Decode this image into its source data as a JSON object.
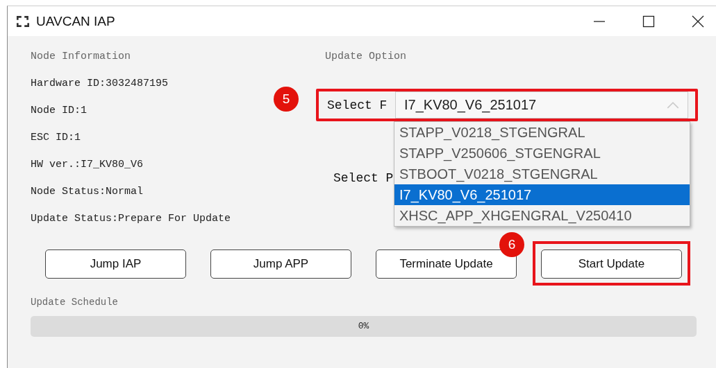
{
  "window": {
    "title": "UAVCAN IAP"
  },
  "node_information": {
    "heading": "Node Information",
    "lines": [
      "Hardware ID:3032487195",
      "Node ID:1",
      "ESC ID:1",
      "HW ver.:I7_KV80_V6",
      "Node Status:Normal",
      "Update Status:Prepare For Update"
    ]
  },
  "update_option": {
    "heading": "Update Option",
    "rows": [
      {
        "kind": "combo",
        "label": "Select F",
        "value": "I7_KV80_V6_251017",
        "expanded": true,
        "highlighted": true,
        "badge": "5",
        "options": [
          {
            "label": "STAPP_V0218_STGENGRAL",
            "selected": false
          },
          {
            "label": "STAPP_V250606_STGENGRAL",
            "selected": false
          },
          {
            "label": "STBOOT_V0218_STGENGRAL",
            "selected": false
          },
          {
            "label": "I7_KV80_V6_251017",
            "selected": true
          },
          {
            "label": "XHSC_APP_XHGENGRAL_V250410",
            "selected": false
          }
        ]
      },
      {
        "kind": "label",
        "label": "Select P"
      }
    ]
  },
  "buttons": [
    {
      "label": "Jump IAP",
      "highlighted": false
    },
    {
      "label": "Jump APP",
      "highlighted": false
    },
    {
      "label": "Terminate Update",
      "highlighted": false
    },
    {
      "label": "Start Update",
      "highlighted": true,
      "badge": "6"
    }
  ],
  "update_schedule": {
    "heading": "Update Schedule",
    "level": 0,
    "reading": "0%"
  }
}
